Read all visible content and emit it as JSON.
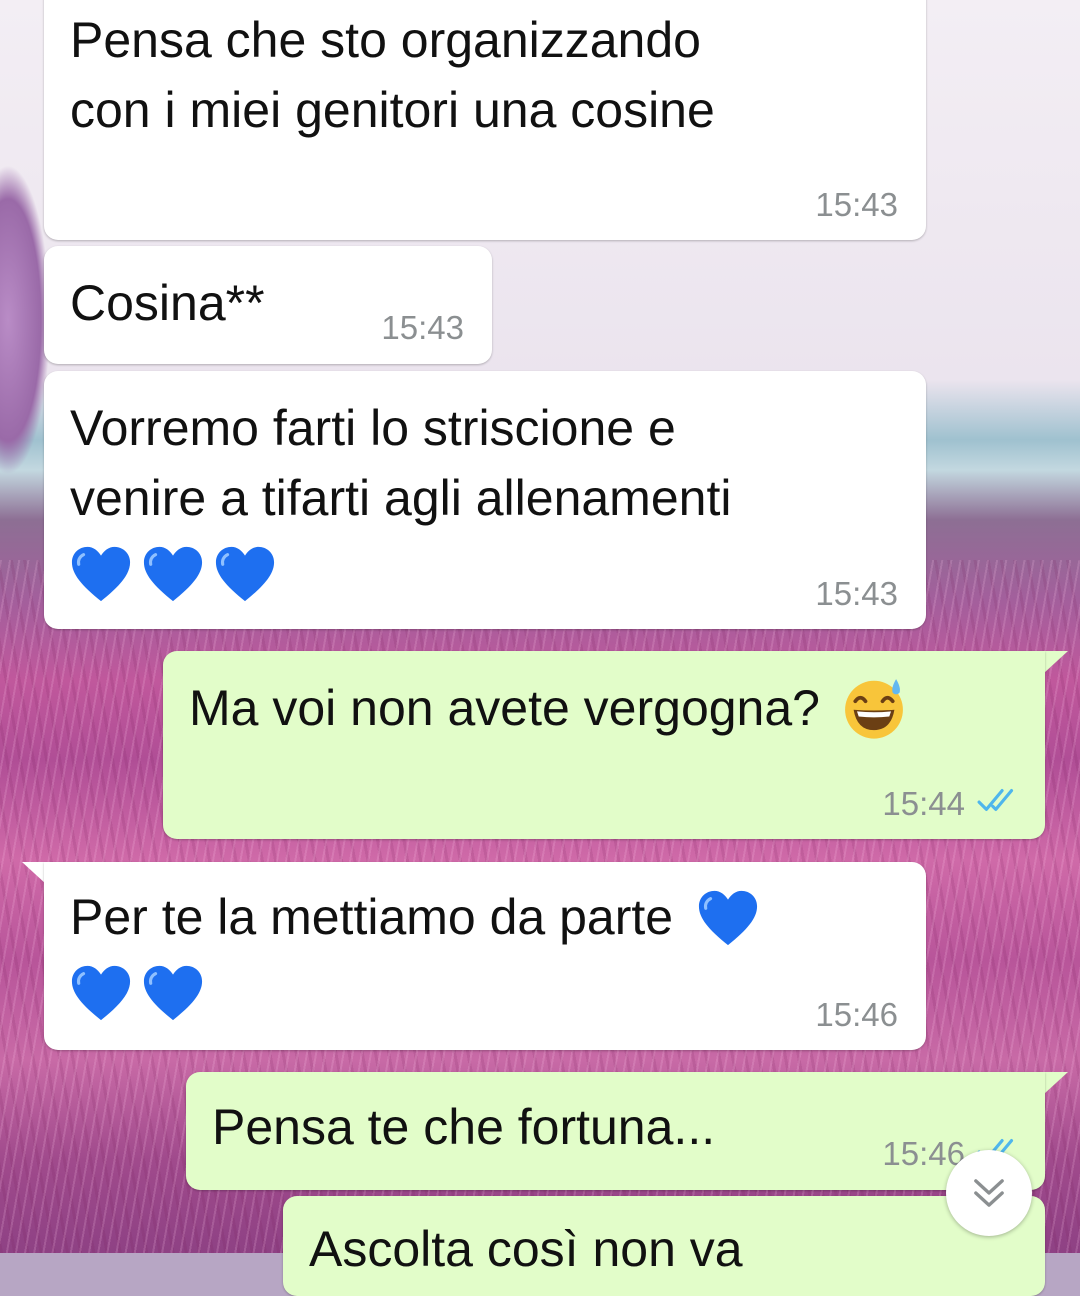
{
  "messages": [
    {
      "id": "m1",
      "direction": "incoming",
      "lines": [
        "Pensa che sto organizzando",
        "con i miei genitori una cosine"
      ],
      "time": "15:43"
    },
    {
      "id": "m2",
      "direction": "incoming",
      "lines": [
        "Cosina**"
      ],
      "time": "15:43"
    },
    {
      "id": "m3",
      "direction": "incoming",
      "lines": [
        "Vorremo farti lo striscione e",
        "venire a tifarti agli allenamenti"
      ],
      "emoji": [
        "blue-heart",
        "blue-heart",
        "blue-heart"
      ],
      "time": "15:43"
    },
    {
      "id": "m4",
      "direction": "outgoing",
      "lines": [
        "Ma voi non avete vergogna?"
      ],
      "emoji": [
        "grinning-sweat"
      ],
      "time": "15:44",
      "status": "read"
    },
    {
      "id": "m5",
      "direction": "incoming",
      "lines": [
        "Per te la mettiamo da parte"
      ],
      "emoji": [
        "blue-heart",
        "blue-heart",
        "blue-heart"
      ],
      "time": "15:46"
    },
    {
      "id": "m6",
      "direction": "outgoing",
      "lines": [
        "Pensa te che fortuna..."
      ],
      "time": "15:46",
      "status": "read"
    },
    {
      "id": "m7",
      "direction": "outgoing",
      "lines": [
        "Ascolta così non va"
      ],
      "partial": true
    }
  ],
  "colors": {
    "incoming_bubble": "#ffffff",
    "outgoing_bubble": "#e2fdc9",
    "timestamp": "#8b8f91",
    "read_ticks": "#4fb6ec",
    "heart": "#1e6ff0"
  },
  "icons": {
    "read_receipt": "double-check-icon",
    "scroll_down": "chevron-down-double-icon"
  }
}
